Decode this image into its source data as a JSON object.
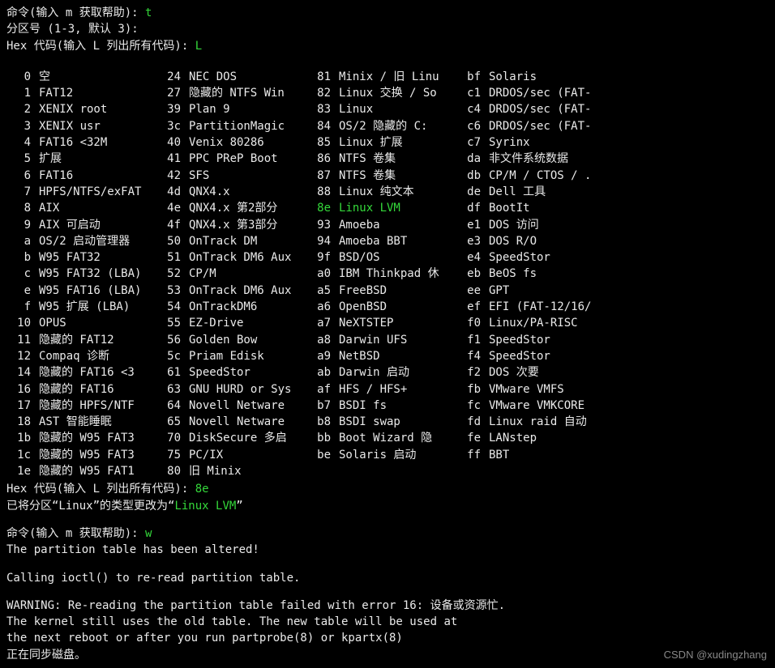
{
  "prompt1_label": "命令(输入 m 获取帮助): ",
  "prompt1_input": "t",
  "partition_prompt": "分区号 (1-3, 默认 3):",
  "hex_prompt_label": "Hex 代码(输入 L 列出所有代码): ",
  "hex_prompt_input": "L",
  "table": {
    "columns": [
      {
        "rows": [
          {
            "code": "0",
            "desc": "空"
          },
          {
            "code": "1",
            "desc": "FAT12"
          },
          {
            "code": "2",
            "desc": "XENIX root"
          },
          {
            "code": "3",
            "desc": "XENIX usr"
          },
          {
            "code": "4",
            "desc": "FAT16 <32M"
          },
          {
            "code": "5",
            "desc": "扩展"
          },
          {
            "code": "6",
            "desc": "FAT16"
          },
          {
            "code": "7",
            "desc": "HPFS/NTFS/exFAT"
          },
          {
            "code": "8",
            "desc": "AIX"
          },
          {
            "code": "9",
            "desc": "AIX 可启动"
          },
          {
            "code": "a",
            "desc": "OS/2 启动管理器"
          },
          {
            "code": "b",
            "desc": "W95 FAT32"
          },
          {
            "code": "c",
            "desc": "W95 FAT32 (LBA)"
          },
          {
            "code": "e",
            "desc": "W95 FAT16 (LBA)"
          },
          {
            "code": "f",
            "desc": "W95 扩展 (LBA)"
          },
          {
            "code": "10",
            "desc": "OPUS"
          },
          {
            "code": "11",
            "desc": "隐藏的 FAT12"
          },
          {
            "code": "12",
            "desc": "Compaq 诊断"
          },
          {
            "code": "14",
            "desc": "隐藏的 FAT16 <3"
          },
          {
            "code": "16",
            "desc": "隐藏的 FAT16"
          },
          {
            "code": "17",
            "desc": "隐藏的 HPFS/NTF"
          },
          {
            "code": "18",
            "desc": "AST 智能睡眠"
          },
          {
            "code": "1b",
            "desc": "隐藏的 W95 FAT3"
          },
          {
            "code": "1c",
            "desc": "隐藏的 W95 FAT3"
          },
          {
            "code": "1e",
            "desc": "隐藏的 W95 FAT1"
          }
        ]
      },
      {
        "rows": [
          {
            "code": "24",
            "desc": "NEC DOS"
          },
          {
            "code": "27",
            "desc": "隐藏的 NTFS Win"
          },
          {
            "code": "39",
            "desc": "Plan 9"
          },
          {
            "code": "3c",
            "desc": "PartitionMagic"
          },
          {
            "code": "40",
            "desc": "Venix 80286"
          },
          {
            "code": "41",
            "desc": "PPC PReP Boot"
          },
          {
            "code": "42",
            "desc": "SFS"
          },
          {
            "code": "4d",
            "desc": "QNX4.x"
          },
          {
            "code": "4e",
            "desc": "QNX4.x 第2部分"
          },
          {
            "code": "4f",
            "desc": "QNX4.x 第3部分"
          },
          {
            "code": "50",
            "desc": "OnTrack DM"
          },
          {
            "code": "51",
            "desc": "OnTrack DM6 Aux"
          },
          {
            "code": "52",
            "desc": "CP/M"
          },
          {
            "code": "53",
            "desc": "OnTrack DM6 Aux"
          },
          {
            "code": "54",
            "desc": "OnTrackDM6"
          },
          {
            "code": "55",
            "desc": "EZ-Drive"
          },
          {
            "code": "56",
            "desc": "Golden Bow"
          },
          {
            "code": "5c",
            "desc": "Priam Edisk"
          },
          {
            "code": "61",
            "desc": "SpeedStor"
          },
          {
            "code": "63",
            "desc": "GNU HURD or Sys"
          },
          {
            "code": "64",
            "desc": "Novell Netware"
          },
          {
            "code": "65",
            "desc": "Novell Netware"
          },
          {
            "code": "70",
            "desc": "DiskSecure 多启"
          },
          {
            "code": "75",
            "desc": "PC/IX"
          },
          {
            "code": "80",
            "desc": "旧 Minix"
          }
        ]
      },
      {
        "rows": [
          {
            "code": "81",
            "desc": "Minix / 旧 Linu"
          },
          {
            "code": "82",
            "desc": "Linux 交换 / So"
          },
          {
            "code": "83",
            "desc": "Linux"
          },
          {
            "code": "84",
            "desc": "OS/2 隐藏的 C:"
          },
          {
            "code": "85",
            "desc": "Linux 扩展"
          },
          {
            "code": "86",
            "desc": "NTFS 卷集"
          },
          {
            "code": "87",
            "desc": "NTFS 卷集"
          },
          {
            "code": "88",
            "desc": "Linux 纯文本"
          },
          {
            "code": "8e",
            "desc": "Linux LVM",
            "highlight": true
          },
          {
            "code": "93",
            "desc": "Amoeba"
          },
          {
            "code": "94",
            "desc": "Amoeba BBT"
          },
          {
            "code": "9f",
            "desc": "BSD/OS"
          },
          {
            "code": "a0",
            "desc": "IBM Thinkpad 休"
          },
          {
            "code": "a5",
            "desc": "FreeBSD"
          },
          {
            "code": "a6",
            "desc": "OpenBSD"
          },
          {
            "code": "a7",
            "desc": "NeXTSTEP"
          },
          {
            "code": "a8",
            "desc": "Darwin UFS"
          },
          {
            "code": "a9",
            "desc": "NetBSD"
          },
          {
            "code": "ab",
            "desc": "Darwin 启动"
          },
          {
            "code": "af",
            "desc": "HFS / HFS+"
          },
          {
            "code": "b7",
            "desc": "BSDI fs"
          },
          {
            "code": "b8",
            "desc": "BSDI swap"
          },
          {
            "code": "bb",
            "desc": "Boot Wizard 隐"
          },
          {
            "code": "be",
            "desc": "Solaris 启动"
          }
        ]
      },
      {
        "rows": [
          {
            "code": "bf",
            "desc": "Solaris"
          },
          {
            "code": "c1",
            "desc": "DRDOS/sec (FAT-"
          },
          {
            "code": "c4",
            "desc": "DRDOS/sec (FAT-"
          },
          {
            "code": "c6",
            "desc": "DRDOS/sec (FAT-"
          },
          {
            "code": "c7",
            "desc": "Syrinx"
          },
          {
            "code": "da",
            "desc": "非文件系统数据"
          },
          {
            "code": "db",
            "desc": "CP/M / CTOS / ."
          },
          {
            "code": "de",
            "desc": "Dell 工具"
          },
          {
            "code": "df",
            "desc": "BootIt"
          },
          {
            "code": "e1",
            "desc": "DOS 访问"
          },
          {
            "code": "e3",
            "desc": "DOS R/O"
          },
          {
            "code": "e4",
            "desc": "SpeedStor"
          },
          {
            "code": "eb",
            "desc": "BeOS fs"
          },
          {
            "code": "ee",
            "desc": "GPT"
          },
          {
            "code": "ef",
            "desc": "EFI (FAT-12/16/"
          },
          {
            "code": "f0",
            "desc": "Linux/PA-RISC"
          },
          {
            "code": "f1",
            "desc": "SpeedStor"
          },
          {
            "code": "f4",
            "desc": "SpeedStor"
          },
          {
            "code": "f2",
            "desc": "DOS 次要"
          },
          {
            "code": "fb",
            "desc": "VMware VMFS"
          },
          {
            "code": "fc",
            "desc": "VMware VMKCORE"
          },
          {
            "code": "fd",
            "desc": "Linux raid 自动"
          },
          {
            "code": "fe",
            "desc": "LANstep"
          },
          {
            "code": "ff",
            "desc": "BBT"
          }
        ]
      }
    ]
  },
  "hex_prompt2_label": "Hex 代码(输入 L 列出所有代码): ",
  "hex_prompt2_input": "8e",
  "changed_a": "已将分区“Linux”的类型更改为“",
  "changed_b": "Linux LVM",
  "changed_c": "”",
  "prompt2_label": "命令(输入 m 获取帮助): ",
  "prompt2_input": "w",
  "altered": "The partition table has been altered!",
  "ioctl": "Calling ioctl() to re-read partition table.",
  "warn1": "WARNING: Re-reading the partition table failed with error 16: 设备或资源忙.",
  "warn2": "The kernel still uses the old table. The new table will be used at",
  "warn3": "the next reboot or after you run partprobe(8) or kpartx(8)",
  "sync": "正在同步磁盘。",
  "watermark": "CSDN @xudingzhang"
}
